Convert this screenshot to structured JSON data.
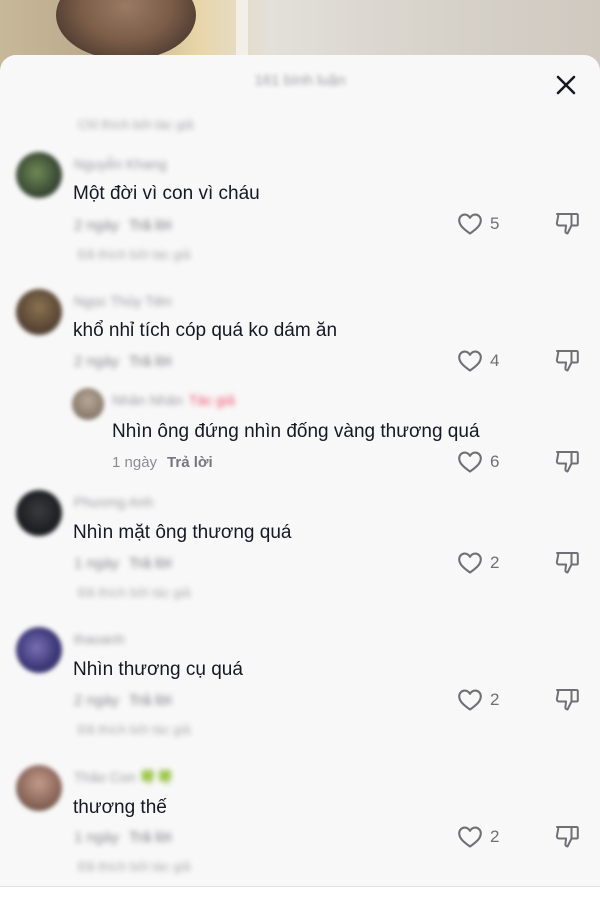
{
  "sheet": {
    "title": "161 bình luận",
    "hidden_notice": "Chỉ thích bởi tác giả"
  },
  "icons": {
    "close": "close-icon",
    "like": "heart-outline-icon",
    "dislike": "thumbs-down-icon"
  },
  "colors": {
    "author_tag": "#f34b69",
    "text": "#161823",
    "muted": "#8b8c91"
  },
  "comments": [
    {
      "username": "Nguyễn Khang",
      "text": "Một đời vì con vì cháu",
      "time": "2 ngày",
      "reply_label": "Trả lời",
      "liked_by": "Đã thích bởi tác giả",
      "likes": "5"
    },
    {
      "username": "Ngọc Thủy Tiên",
      "text": "khổ nhỉ tích cóp quá ko dám ăn",
      "time": "2 ngày",
      "reply_label": "Trả lời",
      "likes": "4",
      "reply": {
        "username": "Nhân Nhân",
        "author_tag": "Tác giả",
        "text": "Nhìn ông đứng nhìn đống vàng thương quá",
        "time": "1 ngày",
        "reply_label": "Trả lời",
        "likes": "6"
      }
    },
    {
      "username": "Phương Anh",
      "text": "Nhìn mặt ông thương quá",
      "time": "1 ngày",
      "reply_label": "Trả lời",
      "liked_by": "Đã thích bởi tác giả",
      "likes": "2"
    },
    {
      "username": "thaoanh",
      "text": "Nhìn thương cụ quá",
      "time": "2 ngày",
      "reply_label": "Trả lời",
      "liked_by": "Đã thích bởi tác giả",
      "likes": "2"
    },
    {
      "username": "Thảo Con 🍀🍀",
      "text": "thương thế",
      "time": "1 ngày",
      "reply_label": "Trả lời",
      "liked_by": "Đã thích bởi tác giả",
      "likes": "2"
    }
  ]
}
